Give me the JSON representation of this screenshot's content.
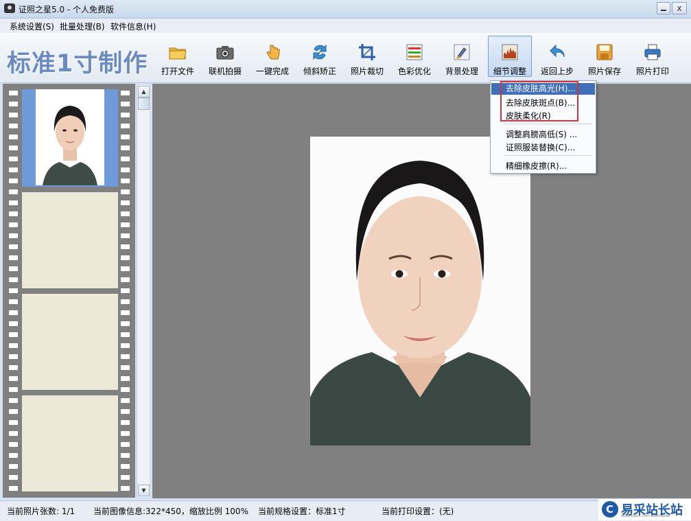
{
  "window": {
    "title": "证照之星5.0 - 个人免费版",
    "close_glyph": "x"
  },
  "menubar": {
    "items": [
      {
        "label": "系统设置(S)"
      },
      {
        "label": "批量处理(B)"
      },
      {
        "label": "软件信息(H)"
      }
    ]
  },
  "toolbar": {
    "brand": "标准1寸制作",
    "buttons": [
      {
        "label": "打开文件",
        "icon": "folder-icon"
      },
      {
        "label": "联机拍摄",
        "icon": "camera-icon"
      },
      {
        "label": "一键完成",
        "icon": "hand-pointer-icon"
      },
      {
        "label": "倾斜矫正",
        "icon": "rotate-icon"
      },
      {
        "label": "照片裁切",
        "icon": "crop-icon"
      },
      {
        "label": "色彩优化",
        "icon": "color-bars-icon"
      },
      {
        "label": "背景处理",
        "icon": "brush-icon"
      },
      {
        "label": "细节调整",
        "icon": "detail-chart-icon",
        "active": true
      },
      {
        "label": "返回上步",
        "icon": "undo-icon"
      },
      {
        "label": "照片保存",
        "icon": "save-disk-icon"
      },
      {
        "label": "照片打印",
        "icon": "printer-icon"
      }
    ]
  },
  "dropdown": {
    "items": [
      {
        "label": "去除皮肤高光(H)..."
      },
      {
        "label": "去除皮肤斑点(B)..."
      },
      {
        "label": "皮肤柔化(R)"
      },
      {
        "label": "调整肩膀高低(S) ..."
      },
      {
        "label": "证照服装替换(C)..."
      },
      {
        "label": "精细橡皮擦(R)..."
      }
    ]
  },
  "statusbar": {
    "photo_count": "当前照片张数: 1/1",
    "image_info": "当前图像信息:322*450，缩放比例 100%",
    "spec": "当前规格设置：标准1寸",
    "print": "当前打印设置：(无)"
  },
  "watermark": {
    "text": "易采站长站",
    "sub": "Www.Easck.Com Webmaster"
  },
  "colors": {
    "brand": "#6b8ac0",
    "highlight": "#3f6fb7",
    "callout": "#d9333f",
    "canvas": "#808080"
  }
}
